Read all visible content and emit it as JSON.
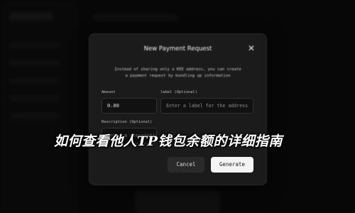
{
  "modal": {
    "title": "New Payment Request",
    "close_icon": "close-icon",
    "description_line1": "Instead of sharing only a KEE address, you can create",
    "description_line2": "a payment request by bundling up information",
    "amount_label": "Amount",
    "amount_value": "0.00",
    "label_label": "label (Optional)",
    "label_placeholder": "Enter a label for the address",
    "description_label": "Description (Optional)",
    "description_placeholder": "Enter a description",
    "cancel_label": "Cancel",
    "generate_label": "Generate"
  },
  "caption": "如何查看他人TP钱包余额的详细指南"
}
